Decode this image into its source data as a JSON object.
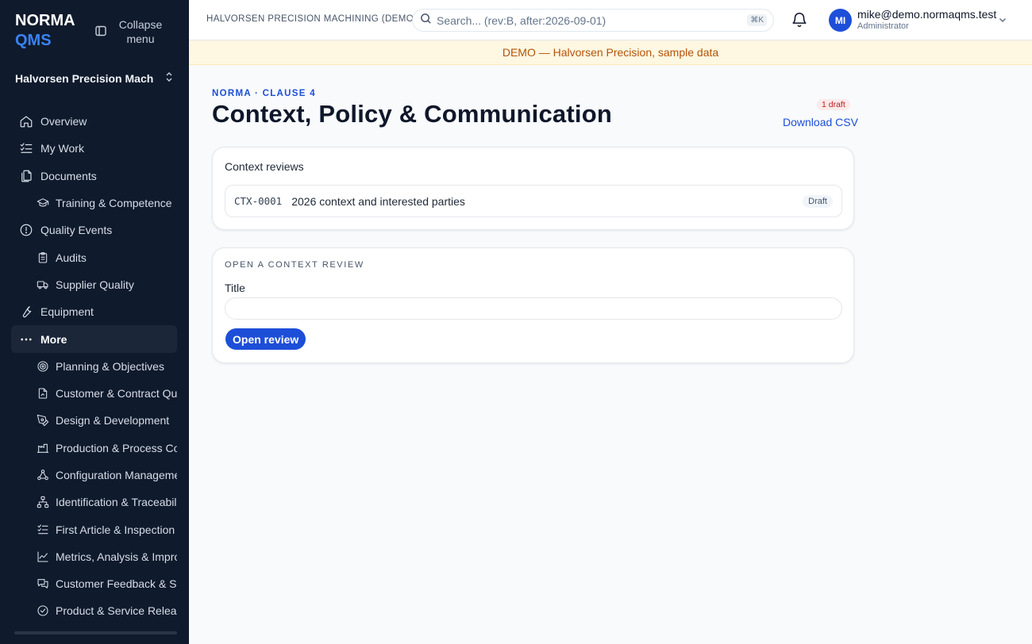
{
  "brand": {
    "line1": "NORMA",
    "line2": "QMS"
  },
  "sidebar": {
    "collapse_label": "Collapse menu",
    "org_switcher": "Halvorsen Precision Machi...",
    "items": [
      {
        "label": "Overview",
        "icon": "home-icon",
        "level": "top"
      },
      {
        "label": "My Work",
        "icon": "checklist-icon",
        "level": "top"
      },
      {
        "label": "Documents",
        "icon": "documents-icon",
        "level": "top"
      },
      {
        "label": "Training & Competence",
        "icon": "graduation-cap-icon",
        "level": "sub"
      },
      {
        "label": "Quality Events",
        "icon": "alert-circle-icon",
        "level": "top"
      },
      {
        "label": "Audits",
        "icon": "clipboard-icon",
        "level": "sub"
      },
      {
        "label": "Supplier Quality",
        "icon": "truck-icon",
        "level": "sub"
      },
      {
        "label": "Equipment",
        "icon": "wrench-icon",
        "level": "top"
      },
      {
        "label": "More",
        "icon": "more-dots-icon",
        "level": "top",
        "active": true
      },
      {
        "label": "Planning & Objectives",
        "icon": "target-icon",
        "level": "sub"
      },
      {
        "label": "Customer & Contract Quality",
        "icon": "file-signature-icon",
        "level": "sub"
      },
      {
        "label": "Design & Development",
        "icon": "pen-tool-icon",
        "level": "sub"
      },
      {
        "label": "Production & Process Control",
        "icon": "factory-icon",
        "level": "sub"
      },
      {
        "label": "Configuration Management",
        "icon": "network-icon",
        "level": "sub"
      },
      {
        "label": "Identification & Traceability",
        "icon": "tree-icon",
        "level": "sub"
      },
      {
        "label": "First Article & Inspection Records",
        "icon": "list-check-icon",
        "level": "sub"
      },
      {
        "label": "Metrics, Analysis & Improvement",
        "icon": "chart-line-icon",
        "level": "sub"
      },
      {
        "label": "Customer Feedback & Satisfaction",
        "icon": "messages-icon",
        "level": "sub"
      },
      {
        "label": "Product & Service Release",
        "icon": "check-circle-icon",
        "level": "sub"
      }
    ]
  },
  "topbar": {
    "org_name": "HALVORSEN PRECISION MACHINING (DEMO)",
    "search_placeholder": "Search... (rev:B, after:2026-09-01)",
    "search_shortcut": "⌘K",
    "avatar_initials": "MI",
    "user_email": "mike@demo.normaqms.test",
    "user_role": "Administrator"
  },
  "banner": "DEMO — Halvorsen Precision, sample data",
  "page": {
    "eyebrow": "NORMA · CLAUSE 4",
    "title": "Context, Policy & Communication",
    "draft_count": "1 draft",
    "download_label": "Download CSV"
  },
  "reviews_card": {
    "title": "Context reviews",
    "rows": [
      {
        "code": "CTX-0001",
        "title": "2026 context and interested parties",
        "status": "Draft"
      }
    ]
  },
  "open_card": {
    "section_label": "OPEN A CONTEXT REVIEW",
    "field_label": "Title",
    "field_value": "",
    "button_label": "Open review"
  }
}
